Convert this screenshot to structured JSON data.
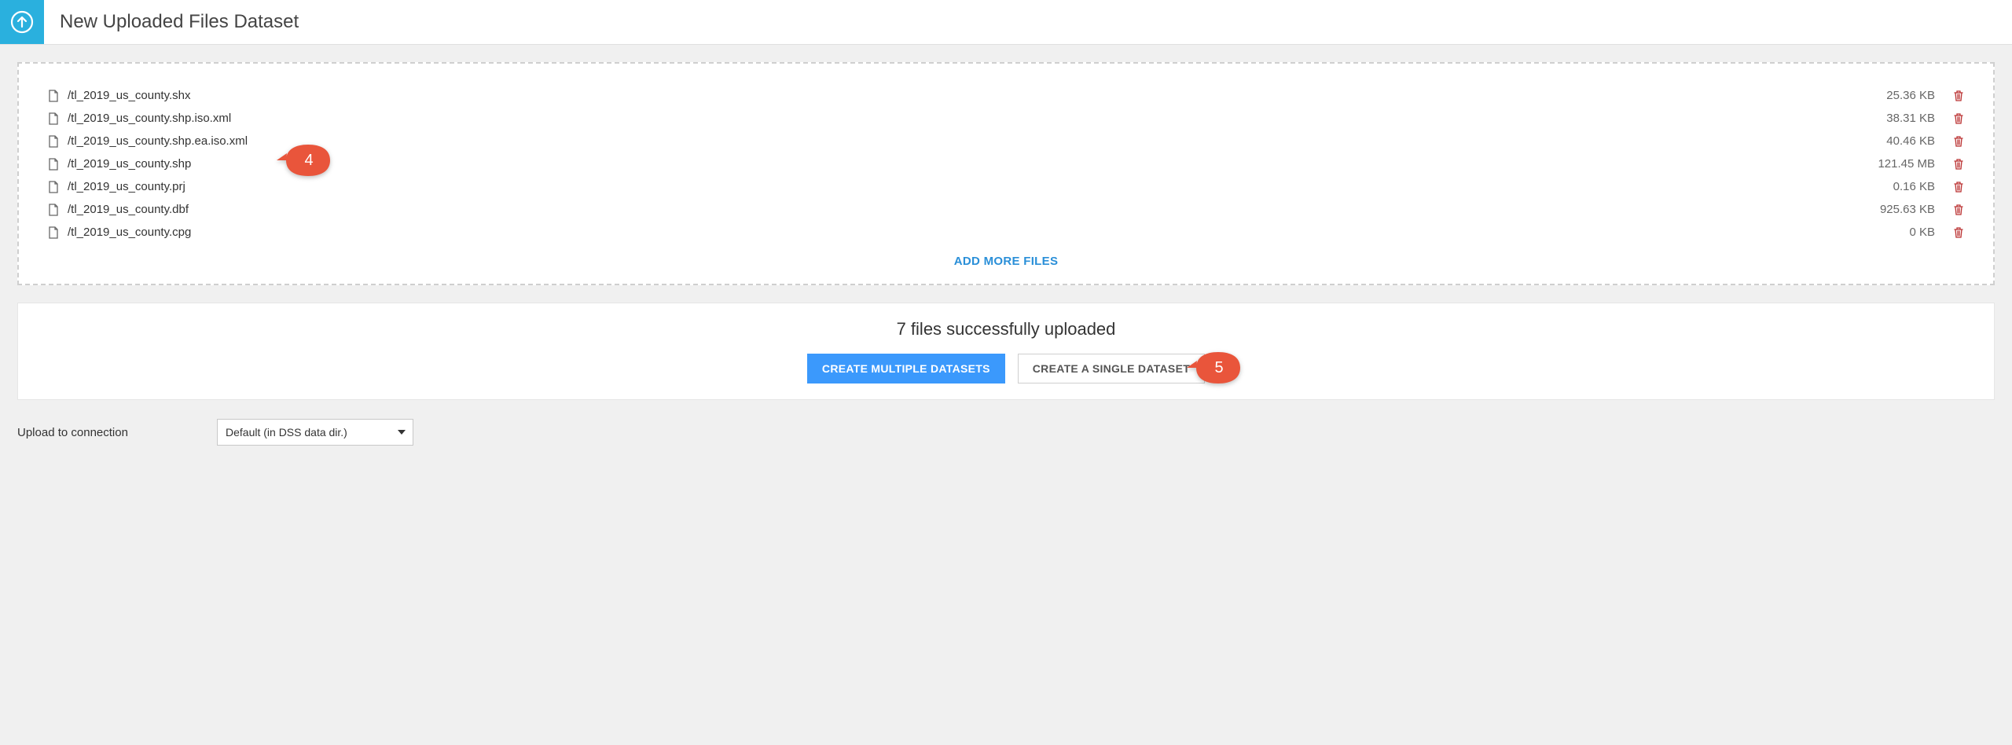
{
  "header": {
    "title": "New Uploaded Files Dataset"
  },
  "files": [
    {
      "name": "/tl_2019_us_county.shx",
      "size": "25.36 KB"
    },
    {
      "name": "/tl_2019_us_county.shp.iso.xml",
      "size": "38.31 KB"
    },
    {
      "name": "/tl_2019_us_county.shp.ea.iso.xml",
      "size": "40.46 KB"
    },
    {
      "name": "/tl_2019_us_county.shp",
      "size": "121.45 MB"
    },
    {
      "name": "/tl_2019_us_county.prj",
      "size": "0.16 KB"
    },
    {
      "name": "/tl_2019_us_county.dbf",
      "size": "925.63 KB"
    },
    {
      "name": "/tl_2019_us_county.cpg",
      "size": "0 KB"
    }
  ],
  "add_more_label": "ADD MORE FILES",
  "status": "7 files successfully uploaded",
  "buttons": {
    "create_multiple": "CREATE MULTIPLE DATASETS",
    "create_single": "CREATE A SINGLE DATASET"
  },
  "connection": {
    "label": "Upload to connection",
    "selected": "Default (in DSS data dir.)"
  },
  "callouts": {
    "c4": "4",
    "c5": "5"
  },
  "colors": {
    "accent": "#3b99fc",
    "upload_icon_bg": "#2ab0de",
    "callout": "#e9553b"
  }
}
